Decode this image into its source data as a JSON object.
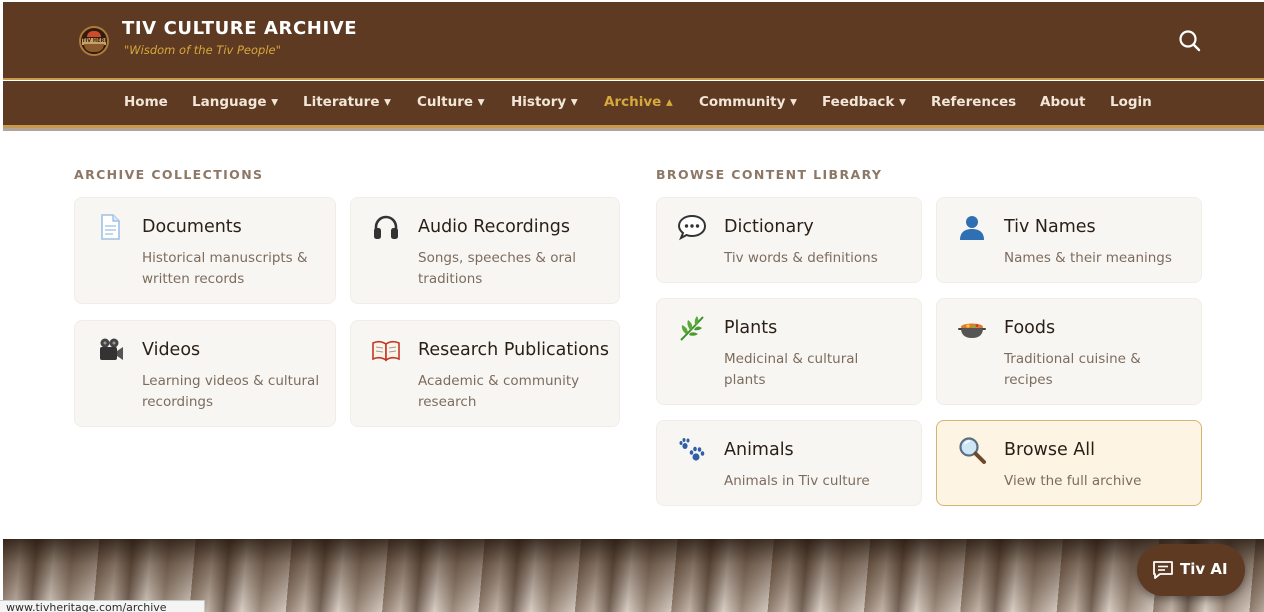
{
  "header": {
    "title": "TIV CULTURE ARCHIVE",
    "tagline": "\"Wisdom of the Tiv People\"",
    "logo_text": "TIV HERITAGE"
  },
  "nav": {
    "items": [
      {
        "label": "Home"
      },
      {
        "label": "Language ▾"
      },
      {
        "label": "Literature ▾"
      },
      {
        "label": "Culture ▾"
      },
      {
        "label": "History ▾"
      },
      {
        "label": "Archive ▴",
        "active": true
      },
      {
        "label": "Community ▾"
      },
      {
        "label": "Feedback ▾"
      },
      {
        "label": "References"
      },
      {
        "label": "About"
      },
      {
        "label": "Login"
      }
    ]
  },
  "archive": {
    "heading": "ARCHIVE COLLECTIONS",
    "cards": [
      {
        "title": "Documents",
        "desc": "Historical manuscripts & written records",
        "icon": "document-icon"
      },
      {
        "title": "Audio Recordings",
        "desc": "Songs, speeches & oral traditions",
        "icon": "headphones-icon"
      },
      {
        "title": "Videos",
        "desc": "Learning videos & cultural recordings",
        "icon": "video-camera-icon"
      },
      {
        "title": "Research Publications",
        "desc": "Academic & community research",
        "icon": "open-book-icon"
      }
    ]
  },
  "library": {
    "heading": "BROWSE CONTENT LIBRARY",
    "cards": [
      {
        "title": "Dictionary",
        "desc": "Tiv words & definitions",
        "icon": "speech-bubble-icon"
      },
      {
        "title": "Tiv Names",
        "desc": "Names & their meanings",
        "icon": "person-icon"
      },
      {
        "title": "Plants",
        "desc": "Medicinal & cultural plants",
        "icon": "herb-icon"
      },
      {
        "title": "Foods",
        "desc": "Traditional cuisine & recipes",
        "icon": "food-pot-icon"
      },
      {
        "title": "Animals",
        "desc": "Animals in Tiv culture",
        "icon": "paw-prints-icon"
      },
      {
        "title": "Browse All",
        "desc": "View the full archive",
        "icon": "magnifier-icon",
        "highlighted": true
      }
    ]
  },
  "chat": {
    "label": "Tiv AI"
  },
  "status_bar": {
    "url": "www.tivheritage.com/archive"
  },
  "colors": {
    "header_bg": "#5e3a22",
    "accent_gold": "#c59a4c",
    "active_nav": "#d6a93c",
    "card_bg": "#f8f6f2",
    "highlight_card_bg": "#fdf4e4"
  }
}
